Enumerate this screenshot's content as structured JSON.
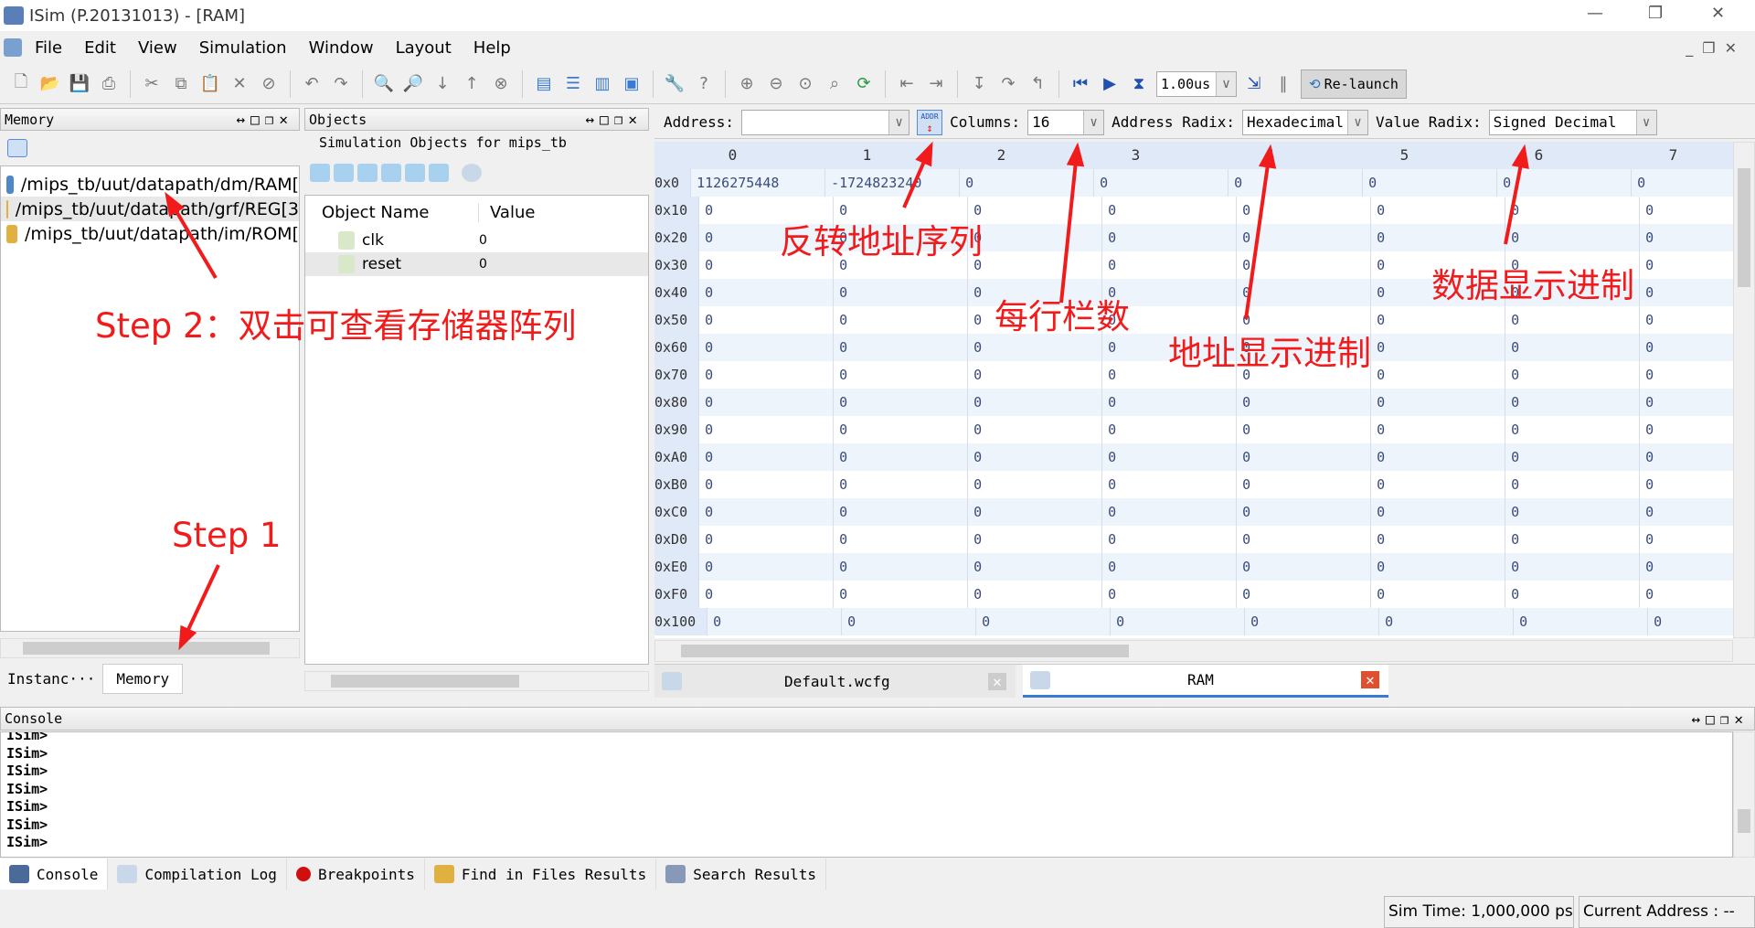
{
  "window": {
    "title": "ISim (P.20131013) - [RAM]"
  },
  "menu": [
    "File",
    "Edit",
    "View",
    "Simulation",
    "Window",
    "Layout",
    "Help"
  ],
  "toolbar": {
    "time_value": "1.00us",
    "relaunch_label": "Re-launch"
  },
  "memory_panel": {
    "title": "Memory",
    "items": [
      "/mips_tb/uut/datapath/dm/RAM[",
      "/mips_tb/uut/datapath/grf/REG[3",
      "/mips_tb/uut/datapath/im/ROM["
    ],
    "tabs": [
      "Instanc···",
      "Memory"
    ]
  },
  "objects_panel": {
    "title": "Objects",
    "subtitle": "Simulation Objects for mips_tb",
    "col_name": "Object Name",
    "col_value": "Value",
    "rows": [
      {
        "name": "clk",
        "value": "0"
      },
      {
        "name": "reset",
        "value": "0"
      }
    ]
  },
  "ram_view": {
    "address_label": "Address:",
    "address_value": "",
    "addr_button": "ADDR",
    "columns_label": "Columns:",
    "columns_value": "16",
    "address_radix_label": "Address Radix:",
    "address_radix_value": "Hexadecimal",
    "value_radix_label": "Value Radix:",
    "value_radix_value": "Signed Decimal",
    "column_headers": [
      "0",
      "1",
      "2",
      "3",
      "4",
      "5",
      "6",
      "7"
    ],
    "addresses": [
      "0x0",
      "0x10",
      "0x20",
      "0x30",
      "0x40",
      "0x50",
      "0x60",
      "0x70",
      "0x80",
      "0x90",
      "0xA0",
      "0xB0",
      "0xC0",
      "0xD0",
      "0xE0",
      "0xF0",
      "0x100"
    ],
    "first_row": [
      "1126275448",
      "-1724823240",
      "0",
      "0",
      "0",
      "0",
      "0",
      "0"
    ],
    "default_value": "0"
  },
  "editor_tabs": [
    "Default.wcfg",
    "RAM"
  ],
  "console": {
    "title": "Console",
    "lines": [
      "ISim>",
      "ISim>",
      "ISim>",
      "ISim>",
      "ISim>",
      "ISim>",
      "ISim>"
    ]
  },
  "bottom_tabs": [
    "Console",
    "Compilation Log",
    "Breakpoints",
    "Find in Files Results",
    "Search Results"
  ],
  "status": {
    "sim_time": "Sim Time: 1,000,000 ps",
    "current_address": "Current Address : --"
  },
  "annotations": {
    "step2": "Step 2：双击可查看存储器阵列",
    "step1": "Step 1",
    "reverse": "反转地址序列",
    "columns": "每行栏数",
    "addr_radix": "地址显示进制",
    "value_radix": "数据显示进制",
    "color": "#f21b1b"
  }
}
